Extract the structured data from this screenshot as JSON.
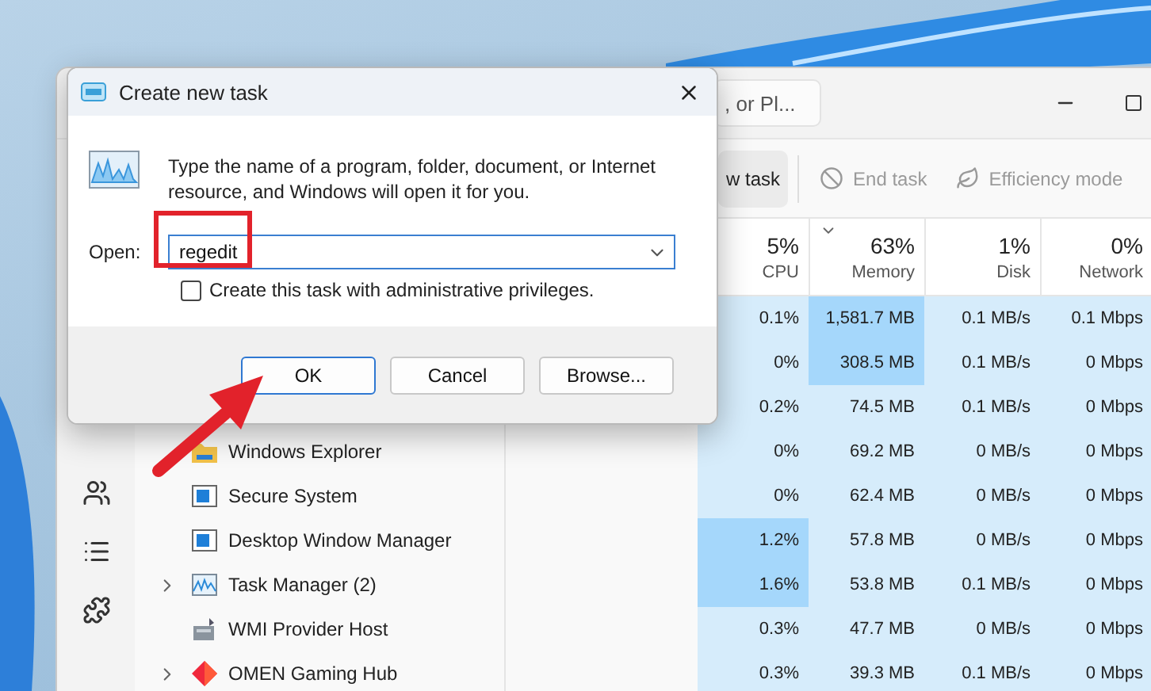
{
  "task_manager": {
    "search": {
      "value": ", or Pl..."
    },
    "toolbar": [
      {
        "label": "w task",
        "kind": "run",
        "disabled": false
      },
      {
        "label": "End task",
        "kind": "end",
        "disabled": true
      },
      {
        "label": "Efficiency mode",
        "kind": "efficiency",
        "disabled": true
      }
    ],
    "columns": [
      {
        "percent": "5%",
        "label": "CPU",
        "sorted": false
      },
      {
        "percent": "63%",
        "label": "Memory",
        "sorted": true
      },
      {
        "percent": "1%",
        "label": "Disk",
        "sorted": false
      },
      {
        "percent": "0%",
        "label": "Network",
        "sorted": false
      }
    ],
    "rows": [
      {
        "cells": [
          {
            "text": "0.1%",
            "hot": false
          },
          {
            "text": "1,581.7 MB",
            "hot": true
          },
          {
            "text": "0.1 MB/s",
            "hot": false
          },
          {
            "text": "0.1 Mbps",
            "hot": false
          }
        ]
      },
      {
        "cells": [
          {
            "text": "0%",
            "hot": false
          },
          {
            "text": "308.5 MB",
            "hot": true
          },
          {
            "text": "0.1 MB/s",
            "hot": false
          },
          {
            "text": "0 Mbps",
            "hot": false
          }
        ]
      },
      {
        "cells": [
          {
            "text": "0.2%",
            "hot": false
          },
          {
            "text": "74.5 MB",
            "hot": false
          },
          {
            "text": "0.1 MB/s",
            "hot": false
          },
          {
            "text": "0 Mbps",
            "hot": false
          }
        ]
      },
      {
        "name": "Windows Explorer",
        "kind": "folder",
        "expandable": false,
        "cells": [
          {
            "text": "0%",
            "hot": false
          },
          {
            "text": "69.2 MB",
            "hot": false
          },
          {
            "text": "0 MB/s",
            "hot": false
          },
          {
            "text": "0 Mbps",
            "hot": false
          }
        ]
      },
      {
        "name": "Secure System",
        "kind": "window",
        "expandable": false,
        "cells": [
          {
            "text": "0%",
            "hot": false
          },
          {
            "text": "62.4 MB",
            "hot": false
          },
          {
            "text": "0 MB/s",
            "hot": false
          },
          {
            "text": "0 Mbps",
            "hot": false
          }
        ]
      },
      {
        "name": "Desktop Window Manager",
        "kind": "window",
        "expandable": false,
        "cells": [
          {
            "text": "1.2%",
            "hot": true
          },
          {
            "text": "57.8 MB",
            "hot": false
          },
          {
            "text": "0 MB/s",
            "hot": false
          },
          {
            "text": "0 Mbps",
            "hot": false
          }
        ]
      },
      {
        "name": "Task Manager (2)",
        "kind": "monitor",
        "expandable": true,
        "cells": [
          {
            "text": "1.6%",
            "hot": true
          },
          {
            "text": "53.8 MB",
            "hot": false
          },
          {
            "text": "0.1 MB/s",
            "hot": false
          },
          {
            "text": "0 Mbps",
            "hot": false
          }
        ]
      },
      {
        "name": "WMI Provider Host",
        "kind": "service",
        "expandable": false,
        "cells": [
          {
            "text": "0.3%",
            "hot": false
          },
          {
            "text": "47.7 MB",
            "hot": false
          },
          {
            "text": "0 MB/s",
            "hot": false
          },
          {
            "text": "0 Mbps",
            "hot": false
          }
        ]
      },
      {
        "name": "OMEN Gaming Hub",
        "kind": "diamond",
        "expandable": true,
        "cells": [
          {
            "text": "0.3%",
            "hot": false
          },
          {
            "text": "39.3 MB",
            "hot": false
          },
          {
            "text": "0.1 MB/s",
            "hot": false
          },
          {
            "text": "0 Mbps",
            "hot": false
          }
        ]
      }
    ]
  },
  "dialog": {
    "title": "Create new task",
    "message": "Type the name of a program, folder, document, or Internet resource, and Windows will open it for you.",
    "open_label": "Open:",
    "open_value": "regedit",
    "admin_checkbox": {
      "label": "Create this task with administrative privileges.",
      "checked": false
    },
    "buttons": [
      {
        "label": "OK",
        "default": true
      },
      {
        "label": "Cancel",
        "default": false
      },
      {
        "label": "Browse...",
        "default": false
      }
    ]
  }
}
